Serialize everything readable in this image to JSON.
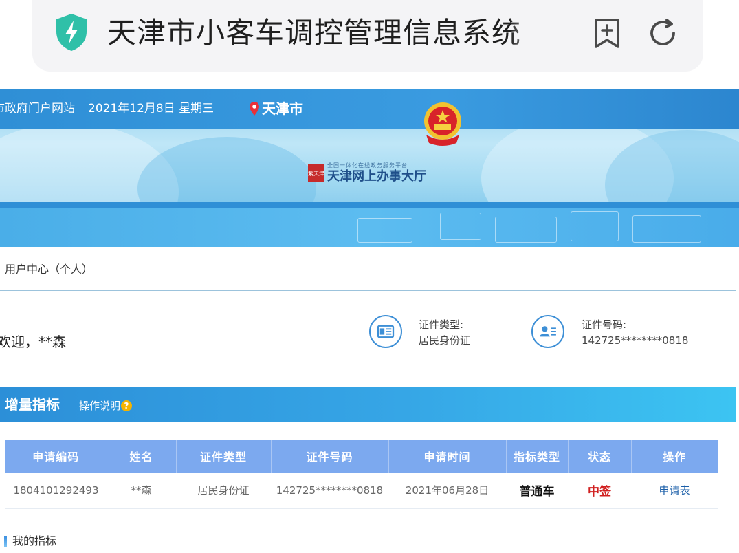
{
  "browser": {
    "title": "天津市小客车调控管理信息系统",
    "security_icon": "shield-bolt-icon",
    "bookmark_icon": "bookmark-add-icon",
    "reload_icon": "reload-icon"
  },
  "banner": {
    "portal_link": "市政府门户网站",
    "date": "2021年12月8日 星期三",
    "city": "天津市",
    "brand_name": "天津网上办事大厅",
    "brand_subtitle": "全国一体化在线政务服务平台",
    "seal_text": "紫天津",
    "emblem_icon": "national-emblem-icon"
  },
  "user_center": {
    "breadcrumb": "用户中心（个人）",
    "welcome": "欢迎，**森",
    "id_type_label": "证件类型:",
    "id_type_value": "居民身份证",
    "id_number_label": "证件号码:",
    "id_number_value": "142725********0818"
  },
  "quota": {
    "title": "增量指标",
    "guide": "操作说明",
    "columns": [
      "申请编码",
      "姓名",
      "证件类型",
      "证件号码",
      "申请时间",
      "指标类型",
      "状态",
      "操作"
    ],
    "rows": [
      {
        "code": "1804101292493",
        "name": "**森",
        "id_type": "居民身份证",
        "id_number": "142725********0818",
        "apply_time": "2021年06月28日",
        "quota_type": "普通车",
        "status": "中签",
        "action": "申请表"
      }
    ]
  },
  "my_quota": {
    "label": "我的指标"
  },
  "colors": {
    "accent_blue": "#2f8fd6",
    "table_header": "#7ca9ef",
    "status_red": "#d12020",
    "link_blue": "#1a5ea8"
  }
}
